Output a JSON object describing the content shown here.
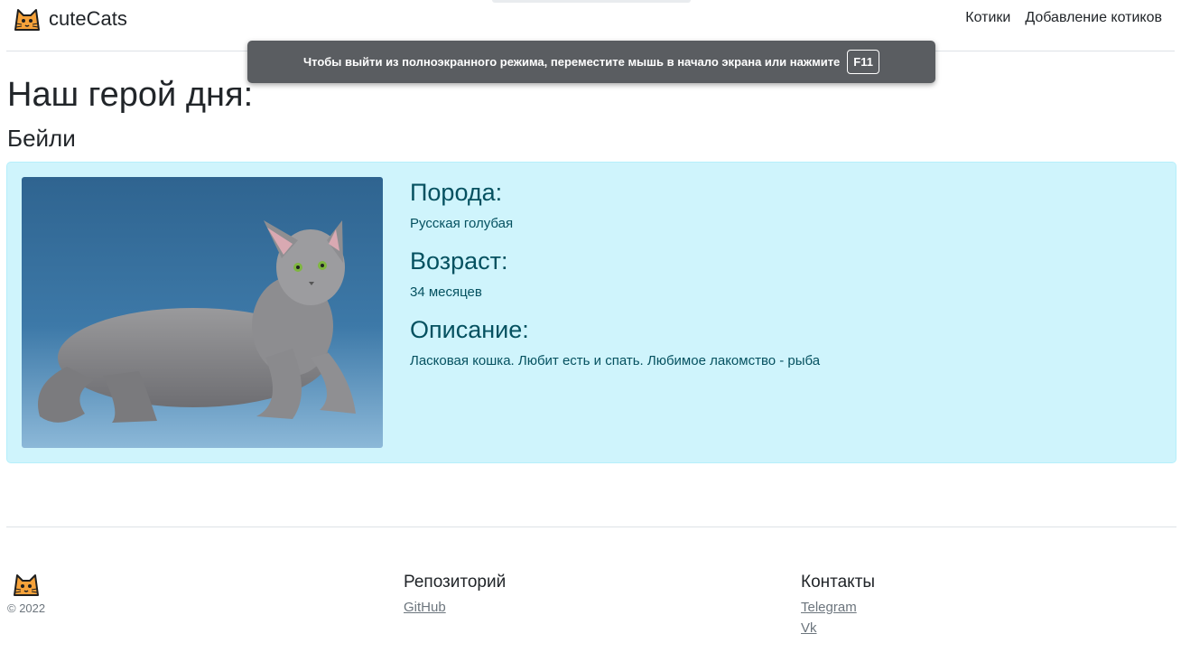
{
  "header": {
    "brand": "cuteCats",
    "logo_icon": "cat-face-icon",
    "nav": [
      {
        "label": "Котики"
      },
      {
        "label": "Добавление котиков"
      }
    ]
  },
  "fullscreen_toast": {
    "message": "Чтобы выйти из полноэкранного режима, переместите мышь в начало экрана или нажмите",
    "key": "F11"
  },
  "main": {
    "heading": "Наш герой дня:",
    "cat_name": "Бейли",
    "photo_icon": "cat-photo",
    "breed_label": "Порода:",
    "breed": "Русская голубая",
    "age_label": "Возраст:",
    "age": "34 месяцев",
    "description_label": "Описание:",
    "description": "Ласковая кошка. Любит есть и спать. Любимое лакомство - рыба"
  },
  "footer": {
    "logo_icon": "cat-face-icon",
    "copyright": "© 2022",
    "repo_heading": "Репозиторий",
    "repo_links": [
      {
        "label": "GitHub"
      }
    ],
    "contacts_heading": "Контакты",
    "contact_links": [
      {
        "label": "Telegram"
      },
      {
        "label": "Vk"
      }
    ]
  },
  "colors": {
    "card_bg": "#cff4fc",
    "card_text": "#055160",
    "toast_bg": "#5a5d61",
    "logo_orange": "#f6a23a"
  }
}
